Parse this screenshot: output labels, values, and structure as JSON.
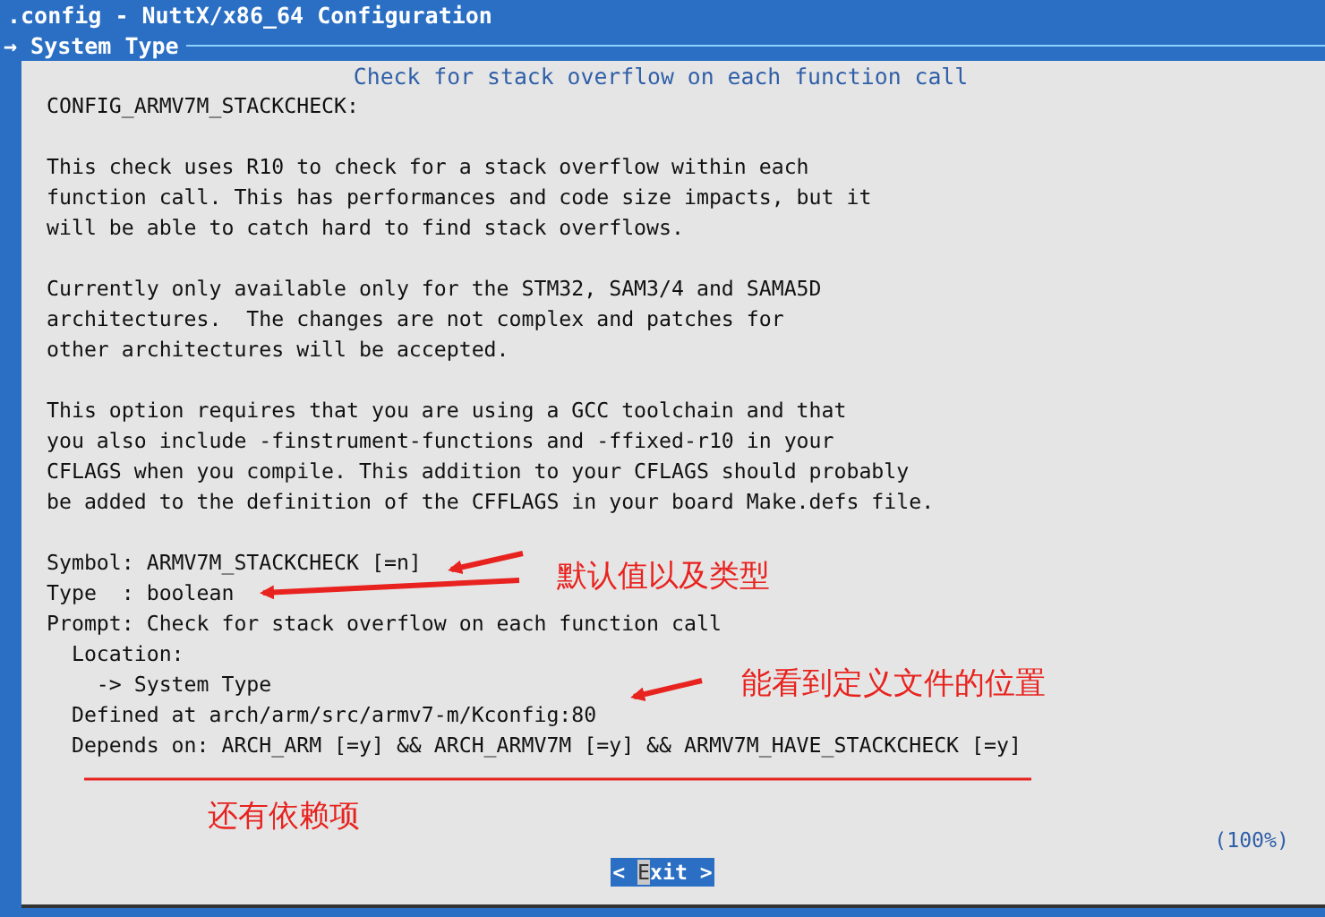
{
  "window": {
    "title": ".config - NuttX/x86_64 Configuration"
  },
  "breadcrumb": {
    "arrow": "→",
    "label": "System Type"
  },
  "dialog": {
    "title": "Check for stack overflow on each function call",
    "paragraphs": [
      [
        "CONFIG_ARMV7M_STACKCHECK:"
      ],
      [
        "This check uses R10 to check for a stack overflow within each",
        "function call. This has performances and code size impacts, but it",
        "will be able to catch hard to find stack overflows."
      ],
      [
        "Currently only available only for the STM32, SAM3/4 and SAMA5D",
        "architectures.  The changes are not complex and patches for",
        "other architectures will be accepted."
      ],
      [
        "This option requires that you are using a GCC toolchain and that",
        "you also include -finstrument-functions and -ffixed-r10 in your",
        "CFLAGS when you compile. This addition to your CFLAGS should probably",
        "be added to the definition of the CFFLAGS in your board Make.defs file."
      ],
      [
        "Symbol: ARMV7M_STACKCHECK [=n]",
        "Type  : boolean",
        "Prompt: Check for stack overflow on each function call",
        "  Location:",
        "    -> System Type",
        "  Defined at arch/arm/src/armv7-m/Kconfig:80",
        "  Depends on: ARCH_ARM [=y] && ARCH_ARMV7M [=y] && ARMV7M_HAVE_STACKCHECK [=y]"
      ]
    ],
    "progress": "(100%)",
    "button": {
      "open": "<",
      "label": "Exit",
      "close": ">"
    }
  },
  "annotations": [
    {
      "text": "默认值以及类型"
    },
    {
      "text": "能看到定义文件的位置"
    },
    {
      "text": "还有依赖项"
    }
  ]
}
